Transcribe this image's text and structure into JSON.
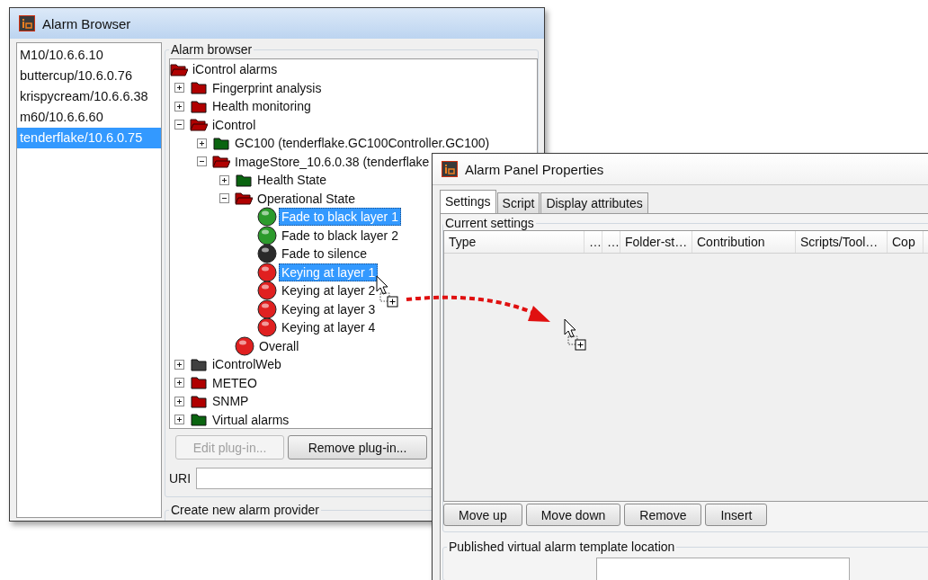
{
  "alarm_browser": {
    "title": "Alarm Browser",
    "hosts": [
      {
        "label": "M10/10.6.6.10",
        "selected": false
      },
      {
        "label": "buttercup/10.6.0.76",
        "selected": false
      },
      {
        "label": "krispycream/10.6.6.38",
        "selected": false
      },
      {
        "label": "m60/10.6.6.60",
        "selected": false
      },
      {
        "label": "tenderflake/10.6.0.75",
        "selected": true
      }
    ],
    "group_title": "Alarm browser",
    "tree": {
      "label": "iControl alarms",
      "kind": "folder",
      "color": "#b00000",
      "expanded": true,
      "selected": false,
      "children": [
        {
          "label": "Fingerprint analysis",
          "kind": "folder",
          "color": "#b00000",
          "expanded": false,
          "selected": false
        },
        {
          "label": "Health monitoring",
          "kind": "folder",
          "color": "#b00000",
          "expanded": false,
          "selected": false
        },
        {
          "label": "iControl",
          "kind": "folder",
          "color": "#b00000",
          "expanded": true,
          "selected": false,
          "children": [
            {
              "label": "GC100 (tenderflake.GC100Controller.GC100)",
              "kind": "folder",
              "color": "#0a6410",
              "expanded": false,
              "selected": false
            },
            {
              "label": "ImageStore_10.6.0.38 (tenderflake",
              "kind": "folder",
              "color": "#b00000",
              "expanded": true,
              "selected": false,
              "children": [
                {
                  "label": "Health State",
                  "kind": "folder",
                  "color": "#0a6410",
                  "expanded": false,
                  "selected": false
                },
                {
                  "label": "Operational State",
                  "kind": "folder",
                  "color": "#b00000",
                  "expanded": true,
                  "selected": false,
                  "children": [
                    {
                      "label": "Fade to black layer 1",
                      "kind": "led",
                      "color": "#2c9a2c",
                      "selected": true
                    },
                    {
                      "label": "Fade to black layer 2",
                      "kind": "led",
                      "color": "#2c9a2c",
                      "selected": false
                    },
                    {
                      "label": "Fade to silence",
                      "kind": "led",
                      "color": "#2a2a2a",
                      "selected": false
                    },
                    {
                      "label": "Keying at layer 1",
                      "kind": "led",
                      "color": "#e02020",
                      "selected": true
                    },
                    {
                      "label": "Keying at layer 2",
                      "kind": "led",
                      "color": "#e02020",
                      "selected": false
                    },
                    {
                      "label": "Keying at layer 3",
                      "kind": "led",
                      "color": "#e02020",
                      "selected": false
                    },
                    {
                      "label": "Keying at layer 4",
                      "kind": "led",
                      "color": "#e02020",
                      "selected": false
                    }
                  ]
                },
                {
                  "label": "Overall",
                  "kind": "led",
                  "color": "#e02020",
                  "selected": false
                }
              ]
            }
          ]
        },
        {
          "label": "iControlWeb",
          "kind": "folder",
          "color": "#404040",
          "expanded": false,
          "selected": false
        },
        {
          "label": "METEO",
          "kind": "folder",
          "color": "#b00000",
          "expanded": false,
          "selected": false
        },
        {
          "label": "SNMP",
          "kind": "folder",
          "color": "#b00000",
          "expanded": false,
          "selected": false
        },
        {
          "label": "Virtual alarms",
          "kind": "folder",
          "color": "#0a6410",
          "expanded": false,
          "selected": false
        }
      ]
    },
    "buttons": [
      {
        "label": "Edit plug-in...",
        "disabled": true
      },
      {
        "label": "Remove plug-in...",
        "disabled": false
      }
    ],
    "uri_label": "URI",
    "create_group_title": "Create new alarm provider"
  },
  "alarm_panel": {
    "title": "Alarm Panel Properties",
    "tabs": [
      {
        "label": "Settings",
        "selected": true
      },
      {
        "label": "Script",
        "selected": false
      },
      {
        "label": "Display attributes",
        "selected": false
      }
    ],
    "group_title": "Current settings",
    "columns": [
      "Type",
      "…",
      "…",
      "Folder-st…",
      "Contribution",
      "Scripts/Tool…",
      "Cop"
    ],
    "buttons": [
      "Move up",
      "Move down",
      "Remove",
      "Insert"
    ],
    "published_group_title": "Published virtual alarm template location"
  }
}
